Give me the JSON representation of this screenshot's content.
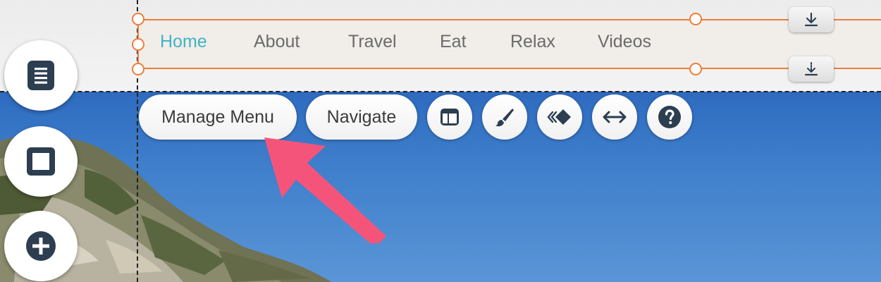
{
  "menu": {
    "items": [
      {
        "label": "Home",
        "active": true
      },
      {
        "label": "About",
        "active": false
      },
      {
        "label": "Travel",
        "active": false
      },
      {
        "label": "Eat",
        "active": false
      },
      {
        "label": "Relax",
        "active": false
      },
      {
        "label": "Videos",
        "active": false
      }
    ]
  },
  "toolbar": {
    "manage_menu_label": "Manage Menu",
    "navigate_label": "Navigate",
    "icons": [
      "layout-icon",
      "paintbrush-icon",
      "animation-icon",
      "stretch-icon",
      "help-icon"
    ]
  },
  "left_panel": {
    "buttons": [
      "pages-icon",
      "square-icon",
      "add-icon"
    ]
  },
  "colors": {
    "accent_active": "#3fb4c4",
    "selection_border": "#ee7d3b",
    "annotation_arrow": "#f5547a",
    "icon_dark": "#2c3e50"
  }
}
